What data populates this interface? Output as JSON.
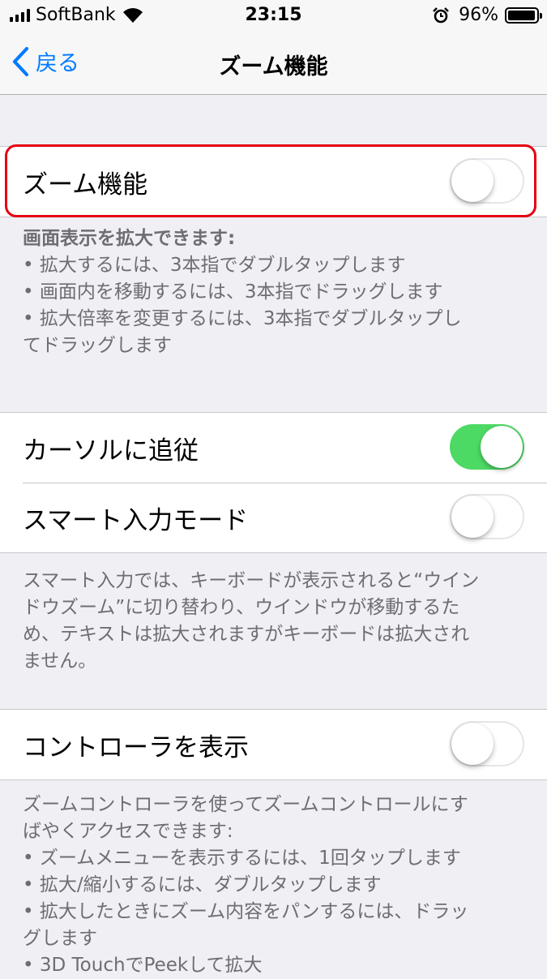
{
  "status_bar": {
    "carrier": "SoftBank",
    "time": "23:15",
    "battery_percent": "96%",
    "battery_level": 0.96,
    "icons": [
      "signal-icon",
      "wifi-icon",
      "alarm-icon",
      "battery-icon"
    ]
  },
  "nav": {
    "back_label": "戻る",
    "title": "ズーム機能"
  },
  "zoom": {
    "label": "ズーム機能",
    "toggle_on": false,
    "footer_title": "画面表示を拡大できます:",
    "footer_lines": [
      "•  拡大するには、3本指でダブルタップします",
      "•  画面内を移動するには、3本指でドラッグします",
      "•  拡大倍率を変更するには、3本指でダブルタップし",
      "てドラッグします"
    ]
  },
  "follow_cursor": {
    "label": "カーソルに追従",
    "toggle_on": true
  },
  "smart_typing": {
    "label": "スマート入力モード",
    "toggle_on": false,
    "footer_lines": [
      "スマート入力では、キーボードが表示されると“ウイン",
      "ドウズーム”に切り替わり、ウインドウが移動するた",
      "め、テキストは拡大されますがキーボードは拡大され",
      "ません。"
    ]
  },
  "show_controller": {
    "label": "コントローラを表示",
    "toggle_on": false,
    "footer_lines": [
      "ズームコントローラを使ってズームコントロールにす",
      "ばやくアクセスできます:",
      "• ズームメニューを表示するには、1回タップします",
      "• 拡大/縮小するには、ダブルタップします",
      "• 拡大したときにズーム内容をパンするには、ドラッ",
      "グします",
      "• 3D TouchでPeekして拡大"
    ]
  },
  "colors": {
    "accent": "#007aff",
    "toggle_on": "#4cd964",
    "highlight": "#e60012",
    "background": "#efeff4"
  }
}
